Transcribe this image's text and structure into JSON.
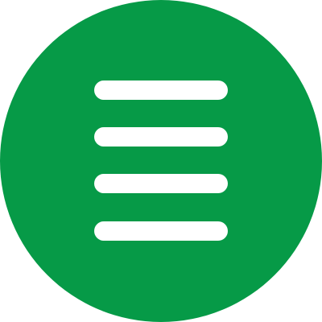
{
  "menu_button": {
    "icon": "hamburger-menu-icon",
    "background_color": "#069A47",
    "icon_color": "#FFFFFF",
    "line_count": 4
  }
}
